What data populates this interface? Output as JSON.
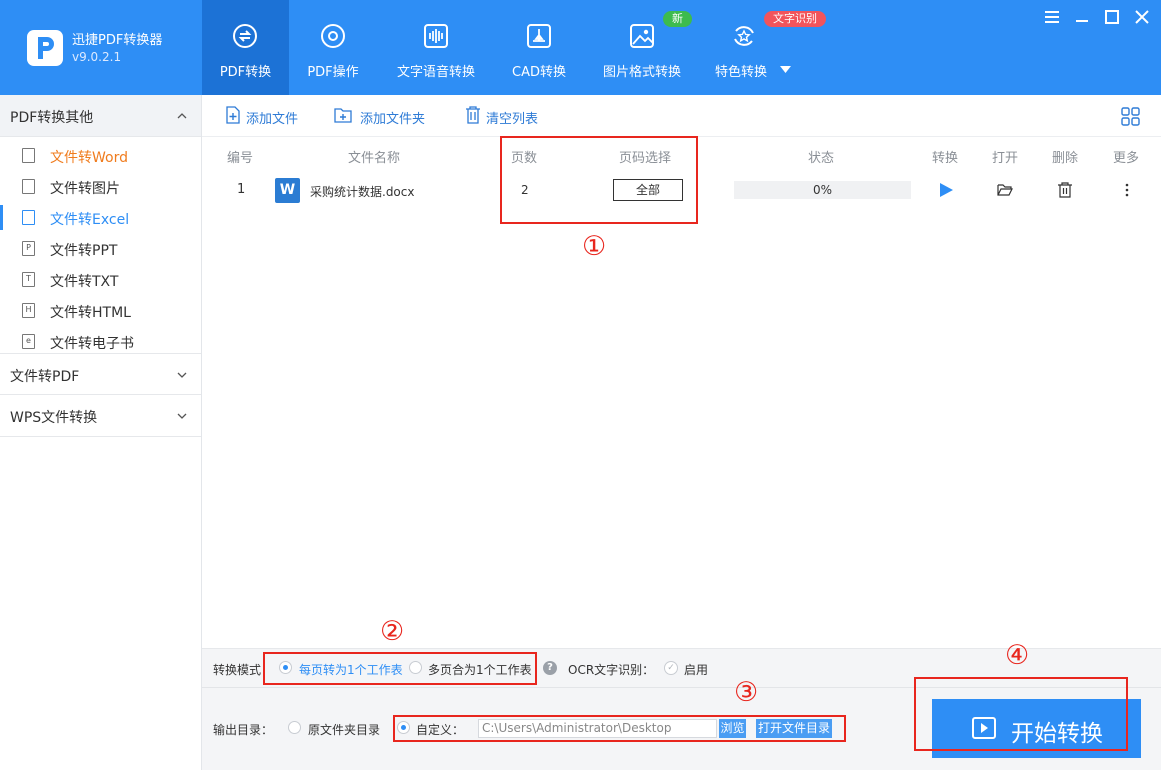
{
  "app": {
    "name": "迅捷PDF转换器",
    "version": "v9.0.2.1"
  },
  "nav": {
    "items": [
      {
        "label": "PDF转换",
        "icon": "pdf-convert-icon"
      },
      {
        "label": "PDF操作",
        "icon": "pdf-operate-icon"
      },
      {
        "label": "文字语音转换",
        "icon": "voice-wave-icon"
      },
      {
        "label": "CAD转换",
        "icon": "cad-icon"
      },
      {
        "label": "图片格式转换",
        "icon": "image-icon"
      },
      {
        "label": "特色转换",
        "icon": "star-convert-icon"
      }
    ],
    "badge_new": "新",
    "badge_ocr": "文字识别",
    "badge_new_color": "#3dbb4e",
    "badge_ocr_color": "#f2545b"
  },
  "sidebar": {
    "sections": [
      {
        "title": "PDF转换其他"
      },
      {
        "title": "文件转PDF"
      },
      {
        "title": "WPS文件转换"
      }
    ],
    "items": [
      {
        "label": "文件转Word",
        "icon_text": ""
      },
      {
        "label": "文件转图片",
        "icon_text": ""
      },
      {
        "label": "文件转Excel",
        "icon_text": ""
      },
      {
        "label": "文件转PPT",
        "icon_text": "P"
      },
      {
        "label": "文件转TXT",
        "icon_text": "T"
      },
      {
        "label": "文件转HTML",
        "icon_text": "H"
      },
      {
        "label": "文件转电子书",
        "icon_text": "e"
      }
    ]
  },
  "toolbar": {
    "add_file": "添加文件",
    "add_folder": "添加文件夹",
    "clear_list": "清空列表"
  },
  "table": {
    "headers": {
      "index": "编号",
      "filename": "文件名称",
      "pages": "页数",
      "page_range": "页码选择",
      "status": "状态",
      "convert": "转换",
      "open": "打开",
      "delete": "删除",
      "more": "更多"
    },
    "rows": [
      {
        "index": "1",
        "filename": "采购统计数据.docx",
        "pages": "2",
        "page_range": "全部",
        "progress": 0,
        "progress_text": "0%"
      }
    ]
  },
  "annotations": {
    "n1": "①",
    "n2": "②",
    "n3": "③",
    "n4": "④"
  },
  "bottom": {
    "mode_label": "转换模式：",
    "mode_option1": "每页转为1个工作表",
    "mode_option2": "多页合为1个工作表",
    "ocr_label": "OCR文字识别：",
    "ocr_enable": "启用",
    "output_label": "输出目录：",
    "output_option1": "原文件夹目录",
    "output_option2": "自定义：",
    "output_path": "C:\\Users\\Administrator\\Desktop",
    "browse": "浏览",
    "open_dir": "打开文件目录",
    "start": "开始转换"
  },
  "colors": {
    "accent": "#2e8ef5",
    "annotation_red": "#e8261e",
    "active_item": "#f07c1e"
  }
}
